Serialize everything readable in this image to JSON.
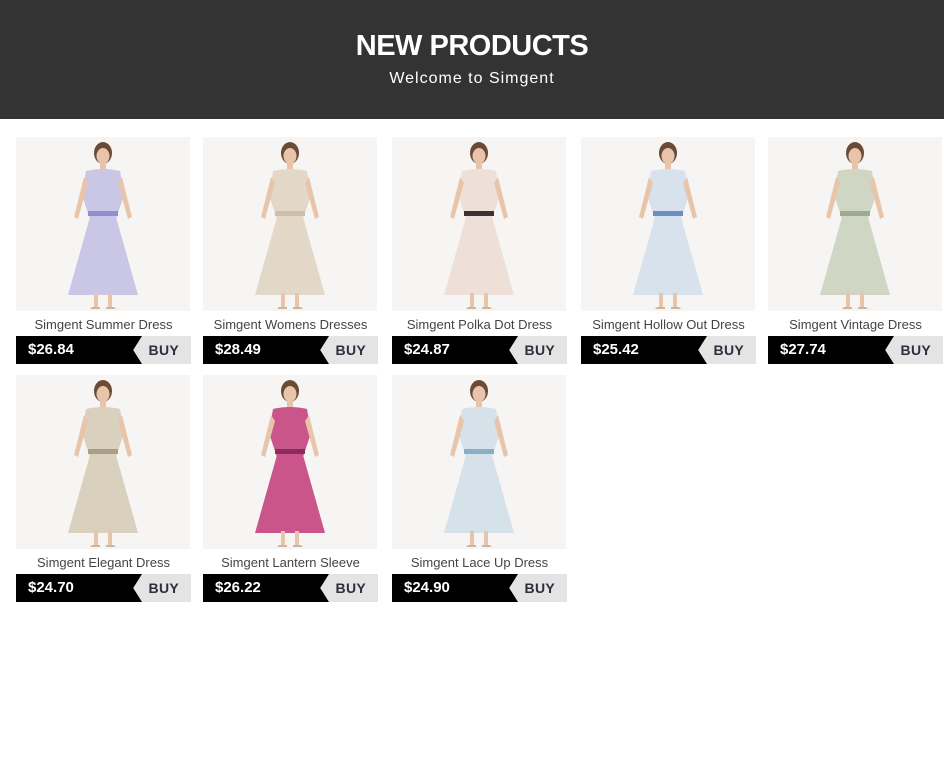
{
  "header": {
    "title": "NEW PRODUCTS",
    "subtitle": "Welcome to Simgent"
  },
  "buy_label": "BUY",
  "products": [
    {
      "name": "Simgent Summer Dress",
      "price": "$26.84",
      "dress_color": "#c9c6e6",
      "accent_color": "#8f8fd0"
    },
    {
      "name": "Simgent Womens Dresses",
      "price": "$28.49",
      "dress_color": "#e3d8c8",
      "accent_color": "#cdbfa8"
    },
    {
      "name": "Simgent Polka Dot Dress",
      "price": "$24.87",
      "dress_color": "#eee0d6",
      "accent_color": "#3a3232"
    },
    {
      "name": "Simgent Hollow Out Dress",
      "price": "$25.42",
      "dress_color": "#d8e2ec",
      "accent_color": "#6b8fc2"
    },
    {
      "name": "Simgent Vintage Dress",
      "price": "$27.74",
      "dress_color": "#cfd7c4",
      "accent_color": "#9eab92"
    },
    {
      "name": "Simgent Elegant Dress",
      "price": "$24.70",
      "dress_color": "#d9d1be",
      "accent_color": "#a89f86"
    },
    {
      "name": "Simgent Lantern Sleeve",
      "price": "$26.22",
      "dress_color": "#c9558a",
      "accent_color": "#8a2d5e"
    },
    {
      "name": "Simgent Lace Up Dress",
      "price": "$24.90",
      "dress_color": "#d6e2ea",
      "accent_color": "#8aaec4"
    }
  ]
}
